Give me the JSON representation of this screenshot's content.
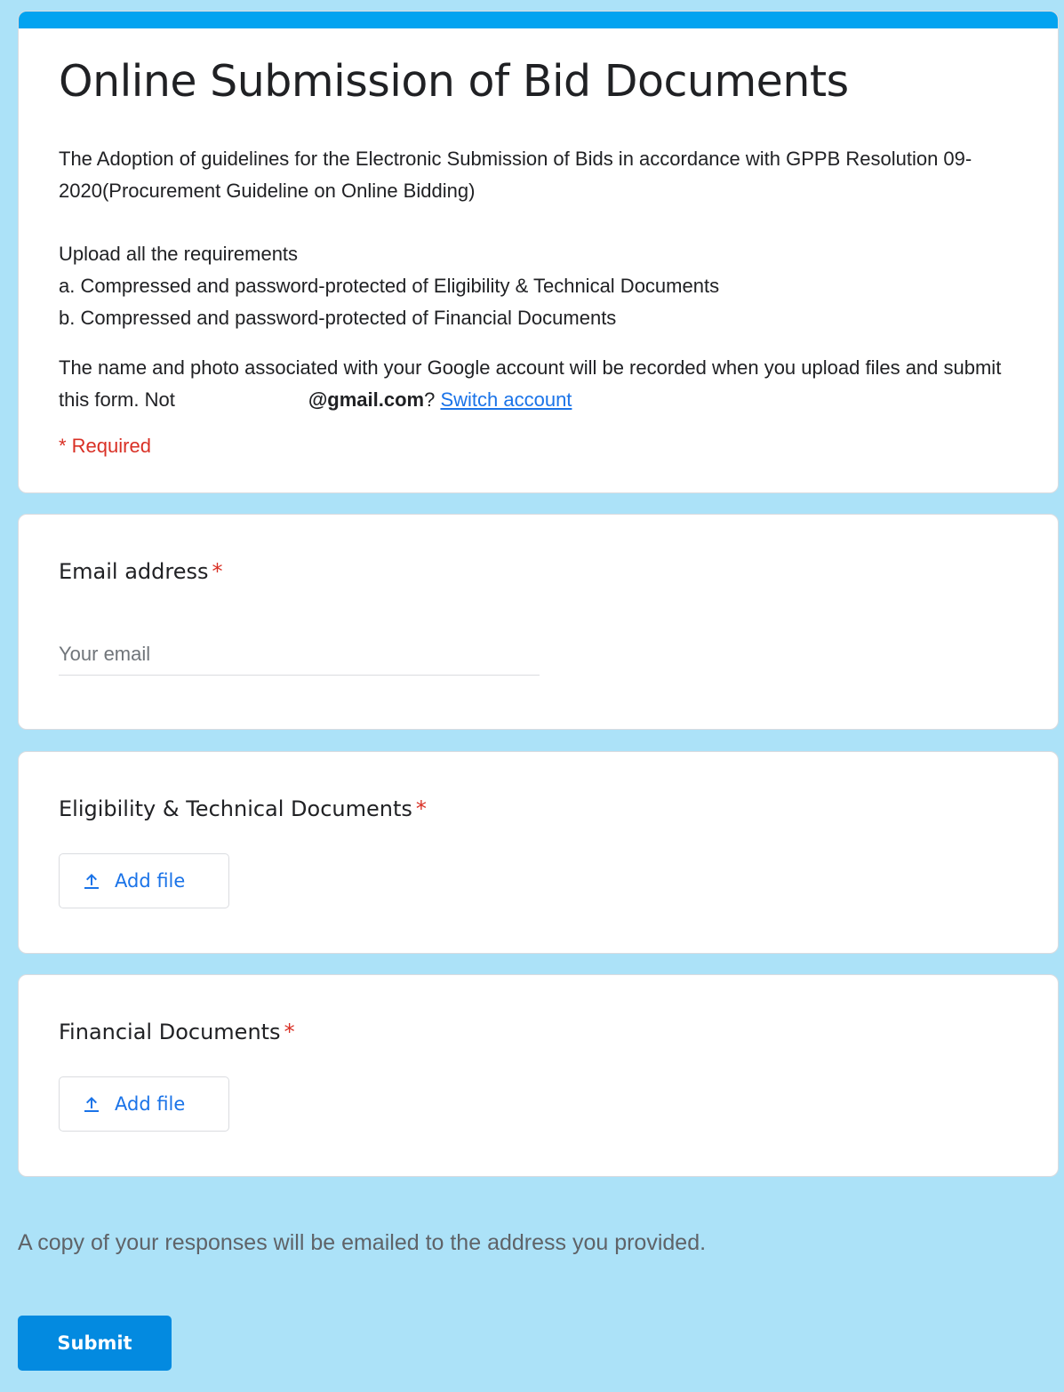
{
  "form": {
    "title": "Online Submission of Bid Documents",
    "description_1": "The Adoption of guidelines for the Electronic Submission of Bids in accordance with GPPB Resolution 09-2020(Procurement Guideline on Online Bidding)",
    "requirements_intro": "Upload all the requirements",
    "requirement_a": "a. Compressed and password-protected of Eligibility & Technical Documents",
    "requirement_b": "b.  Compressed and password-protected of Financial Documents",
    "account_notice": "The name and photo associated with your Google account will be recorded when you upload files and submit this form. Not",
    "account_email": "@gmail.com",
    "account_question_mark": "?",
    "switch_account_label": "Switch account",
    "required_note": "* Required",
    "accent_color": "#03a3f0"
  },
  "questions": {
    "email": {
      "label": "Email address",
      "required_marker": "*",
      "placeholder": "Your email",
      "value": ""
    },
    "eligibility": {
      "label": "Eligibility & Technical Documents",
      "required_marker": "*",
      "button_label": "Add file",
      "icon": "upload-icon"
    },
    "financial": {
      "label": "Financial Documents",
      "required_marker": "*",
      "button_label": "Add file",
      "icon": "upload-icon"
    }
  },
  "footer": {
    "copy_note": "A copy of your responses will be emailed to the address you provided.",
    "submit_label": "Submit"
  }
}
